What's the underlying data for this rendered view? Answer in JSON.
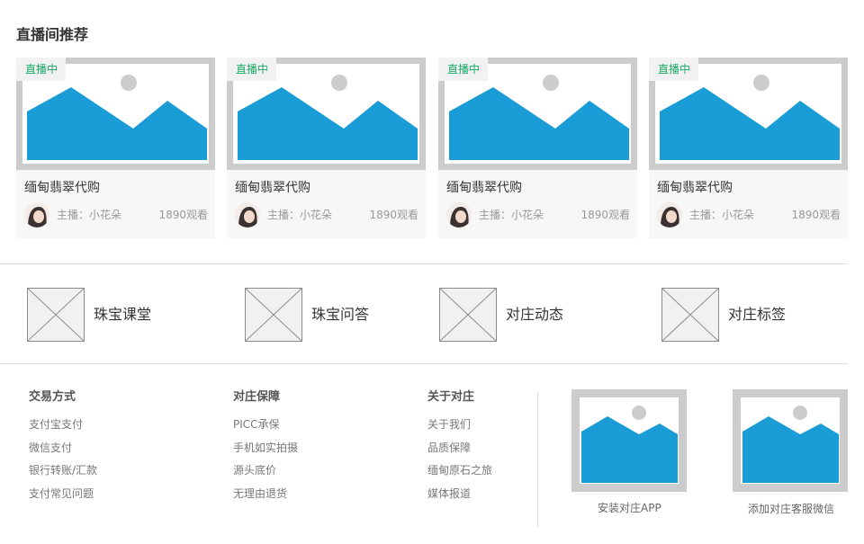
{
  "live_section": {
    "title": "直播间推荐",
    "cards": [
      {
        "badge": "直播中",
        "title": "缅甸翡翠代购",
        "host": "主播：小花朵",
        "views": "1890观看"
      },
      {
        "badge": "直播中",
        "title": "缅甸翡翠代购",
        "host": "主播：小花朵",
        "views": "1890观看"
      },
      {
        "badge": "直播中",
        "title": "缅甸翡翠代购",
        "host": "主播：小花朵",
        "views": "1890观看"
      },
      {
        "badge": "直播中",
        "title": "缅甸翡翠代购",
        "host": "主播：小花朵",
        "views": "1890观看"
      }
    ]
  },
  "categories": [
    {
      "label": "珠宝课堂",
      "icon": "image-placeholder-icon"
    },
    {
      "label": "珠宝问答",
      "icon": "image-placeholder-icon"
    },
    {
      "label": "对庄动态",
      "icon": "image-placeholder-icon"
    },
    {
      "label": "对庄标签",
      "icon": "image-placeholder-icon"
    }
  ],
  "footer": {
    "columns": [
      {
        "heading": "交易方式",
        "links": [
          "支付宝支付",
          "微信支付",
          "银行转账/汇款",
          "支付常见问题"
        ]
      },
      {
        "heading": "对庄保障",
        "links": [
          "PICC承保",
          "手机如实拍摄",
          "源头底价",
          "无理由退货"
        ]
      },
      {
        "heading": "关于对庄",
        "links": [
          "关于我们",
          "品质保障",
          "缅甸原石之旅",
          "媒体报道"
        ]
      }
    ],
    "qr_codes": [
      {
        "caption": "安装对庄APP"
      },
      {
        "caption": "添加对庄客服微信"
      }
    ]
  },
  "colors": {
    "live_badge": "#1aaa66",
    "placeholder_blue": "#1a9cd6",
    "placeholder_frame": "#cccccc"
  }
}
